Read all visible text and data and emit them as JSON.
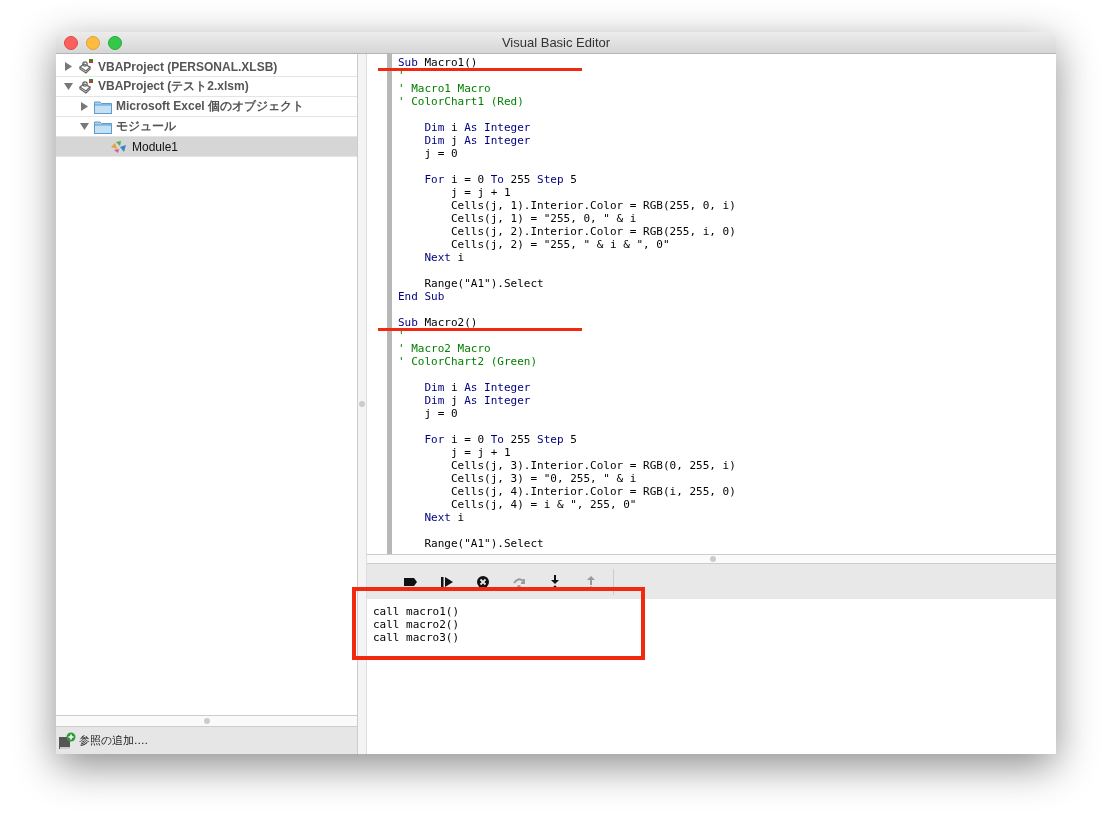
{
  "window": {
    "title": "Visual Basic Editor"
  },
  "project_tree": [
    {
      "kind": "project",
      "label": "VBAProject (PERSONAL.XLSB)",
      "expanded": false,
      "selected": false
    },
    {
      "kind": "project",
      "label": "VBAProject (テスト2.xlsm)",
      "expanded": true,
      "selected": false,
      "children": [
        {
          "kind": "folder",
          "label": "Microsoft Excel 個のオブジェクト",
          "expanded": false,
          "selected": false
        },
        {
          "kind": "folder",
          "label": "モジュール",
          "expanded": true,
          "selected": false,
          "children": [
            {
              "kind": "module",
              "label": "Module1",
              "selected": true
            }
          ]
        }
      ]
    }
  ],
  "references_button": {
    "label": "参照の追加...."
  },
  "code": [
    {
      "marked": true,
      "segments": [
        {
          "kind": "keyword",
          "text": "Sub"
        },
        {
          "kind": "plain",
          "text": " Macro1()"
        }
      ]
    },
    {
      "marked": false,
      "segments": [
        {
          "kind": "comment",
          "text": "'"
        }
      ]
    },
    {
      "marked": false,
      "segments": [
        {
          "kind": "comment",
          "text": "' Macro1 Macro"
        }
      ]
    },
    {
      "marked": false,
      "segments": [
        {
          "kind": "comment",
          "text": "' ColorChart1 (Red)"
        }
      ]
    },
    {
      "marked": false
    },
    {
      "marked": false,
      "segments": [
        {
          "kind": "keyword",
          "text": "    Dim"
        },
        {
          "kind": "plain",
          "text": " i "
        },
        {
          "kind": "keyword",
          "text": "As Integer"
        }
      ]
    },
    {
      "marked": false,
      "segments": [
        {
          "kind": "keyword",
          "text": "    Dim"
        },
        {
          "kind": "plain",
          "text": " j "
        },
        {
          "kind": "keyword",
          "text": "As Integer"
        }
      ]
    },
    {
      "marked": false,
      "segments": [
        {
          "kind": "plain",
          "text": "    j = 0"
        }
      ]
    },
    {
      "marked": false
    },
    {
      "marked": false,
      "segments": [
        {
          "kind": "keyword",
          "text": "    For"
        },
        {
          "kind": "plain",
          "text": " i = 0 "
        },
        {
          "kind": "keyword",
          "text": "To"
        },
        {
          "kind": "plain",
          "text": " 255 "
        },
        {
          "kind": "keyword",
          "text": "Step"
        },
        {
          "kind": "plain",
          "text": " 5"
        }
      ]
    },
    {
      "marked": false,
      "segments": [
        {
          "kind": "plain",
          "text": "        j = j + 1"
        }
      ]
    },
    {
      "marked": false,
      "segments": [
        {
          "kind": "plain",
          "text": "        Cells(j, 1).Interior.Color = RGB(255, 0, i)"
        }
      ]
    },
    {
      "marked": false,
      "segments": [
        {
          "kind": "plain",
          "text": "        Cells(j, 1) = \"255, 0, \" & i"
        }
      ]
    },
    {
      "marked": false,
      "segments": [
        {
          "kind": "plain",
          "text": "        Cells(j, 2).Interior.Color = RGB(255, i, 0)"
        }
      ]
    },
    {
      "marked": false,
      "segments": [
        {
          "kind": "plain",
          "text": "        Cells(j, 2) = \"255, \" & i & \", 0\""
        }
      ]
    },
    {
      "marked": false,
      "segments": [
        {
          "kind": "keyword",
          "text": "    Next"
        },
        {
          "kind": "plain",
          "text": " i"
        }
      ]
    },
    {
      "marked": false
    },
    {
      "marked": false,
      "segments": [
        {
          "kind": "plain",
          "text": "    Range(\"A1\").Select"
        }
      ]
    },
    {
      "marked": false,
      "segments": [
        {
          "kind": "keyword",
          "text": "End Sub"
        }
      ]
    },
    {
      "marked": false
    },
    {
      "marked": true,
      "segments": [
        {
          "kind": "keyword",
          "text": "Sub"
        },
        {
          "kind": "plain",
          "text": " Macro2()"
        }
      ]
    },
    {
      "marked": false,
      "segments": [
        {
          "kind": "comment",
          "text": "'"
        }
      ]
    },
    {
      "marked": false,
      "segments": [
        {
          "kind": "comment",
          "text": "' Macro2 Macro"
        }
      ]
    },
    {
      "marked": false,
      "segments": [
        {
          "kind": "comment",
          "text": "' ColorChart2 (Green)"
        }
      ]
    },
    {
      "marked": false
    },
    {
      "marked": false,
      "segments": [
        {
          "kind": "keyword",
          "text": "    Dim"
        },
        {
          "kind": "plain",
          "text": " i "
        },
        {
          "kind": "keyword",
          "text": "As Integer"
        }
      ]
    },
    {
      "marked": false,
      "segments": [
        {
          "kind": "keyword",
          "text": "    Dim"
        },
        {
          "kind": "plain",
          "text": " j "
        },
        {
          "kind": "keyword",
          "text": "As Integer"
        }
      ]
    },
    {
      "marked": false,
      "segments": [
        {
          "kind": "plain",
          "text": "    j = 0"
        }
      ]
    },
    {
      "marked": false
    },
    {
      "marked": false,
      "segments": [
        {
          "kind": "keyword",
          "text": "    For"
        },
        {
          "kind": "plain",
          "text": " i = 0 "
        },
        {
          "kind": "keyword",
          "text": "To"
        },
        {
          "kind": "plain",
          "text": " 255 "
        },
        {
          "kind": "keyword",
          "text": "Step"
        },
        {
          "kind": "plain",
          "text": " 5"
        }
      ]
    },
    {
      "marked": false,
      "segments": [
        {
          "kind": "plain",
          "text": "        j = j + 1"
        }
      ]
    },
    {
      "marked": false,
      "segments": [
        {
          "kind": "plain",
          "text": "        Cells(j, 3).Interior.Color = RGB(0, 255, i)"
        }
      ]
    },
    {
      "marked": false,
      "segments": [
        {
          "kind": "plain",
          "text": "        Cells(j, 3) = \"0, 255, \" & i"
        }
      ]
    },
    {
      "marked": false,
      "segments": [
        {
          "kind": "plain",
          "text": "        Cells(j, 4).Interior.Color = RGB(i, 255, 0)"
        }
      ]
    },
    {
      "marked": false,
      "segments": [
        {
          "kind": "plain",
          "text": "        Cells(j, 4) = i & \", 255, 0\""
        }
      ]
    },
    {
      "marked": false,
      "segments": [
        {
          "kind": "keyword",
          "text": "    Next"
        },
        {
          "kind": "plain",
          "text": " i"
        }
      ]
    },
    {
      "marked": false
    },
    {
      "marked": false,
      "segments": [
        {
          "kind": "plain",
          "text": "    Range(\"A1\").Select"
        }
      ]
    }
  ],
  "debug_toolbar": [
    {
      "kind": "breakpoint",
      "disabled": false
    },
    {
      "kind": "run",
      "disabled": false
    },
    {
      "kind": "stop",
      "disabled": false
    },
    {
      "kind": "step_over",
      "disabled": true
    },
    {
      "kind": "step_into",
      "disabled": false
    },
    {
      "kind": "step_out",
      "disabled": true
    }
  ],
  "immediate": {
    "framed": true,
    "lines": [
      "call macro1()",
      "call macro2()",
      "call macro3()"
    ]
  }
}
